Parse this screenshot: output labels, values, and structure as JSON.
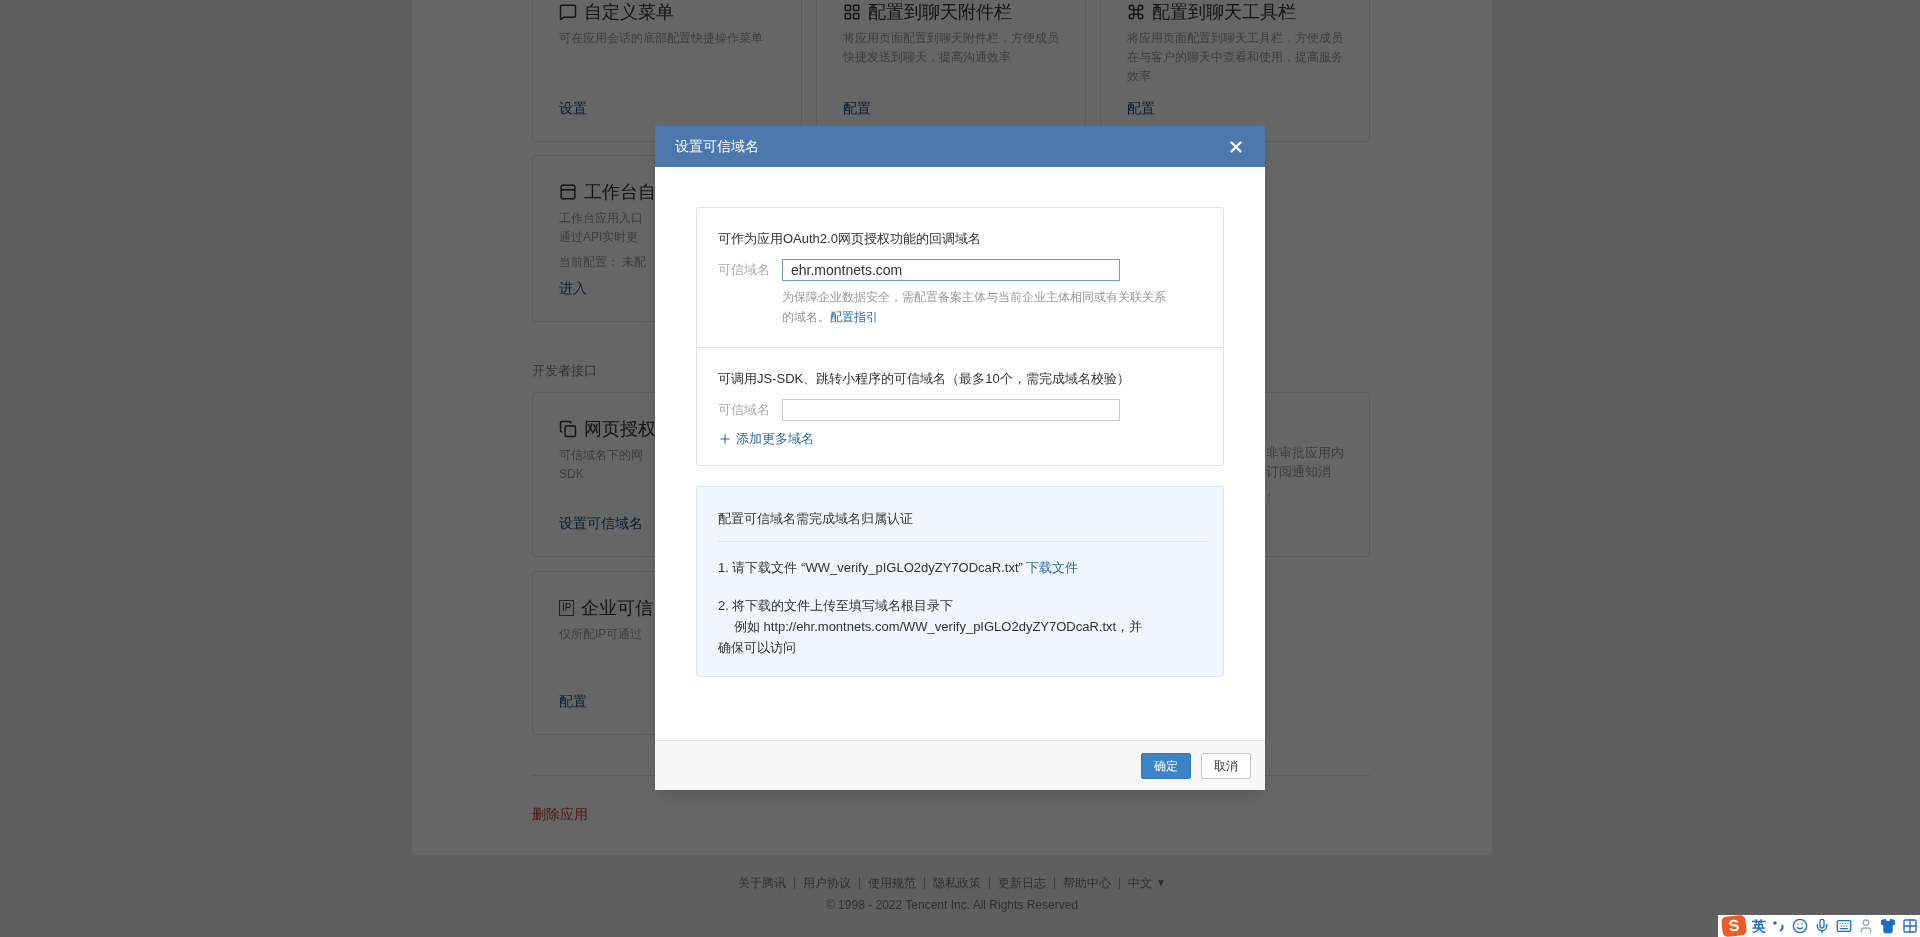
{
  "page": {
    "rows": [
      {
        "cards": [
          {
            "kind": "menu",
            "title": "自定义菜单",
            "description": [
              "可在应用会话的底部配置快捷操作菜单"
            ],
            "action": "设置"
          },
          {
            "kind": "attachment",
            "title": "配置到聊天附件栏",
            "description": [
              "将应用页面配置到聊天附件栏，方便成员",
              "快捷发送到聊天，提高沟通效率"
            ],
            "action": "配置"
          },
          {
            "kind": "toolbar",
            "title": "配置到聊天工具栏",
            "description": [
              "将应用页面配置到聊天工具栏，方便成员",
              "在与客户的聊天中查看和使用，提高服务",
              "效率"
            ],
            "action": "配置"
          }
        ]
      },
      {
        "cards": [
          {
            "kind": "workbench",
            "title": "工作台自",
            "description": [
              "工作台应用入口",
              "通过API实时更"
            ],
            "status": "当前配置： 未配",
            "action": "进入"
          }
        ]
      }
    ],
    "developer_section": {
      "label": "开发者接口",
      "rows": [
        {
          "cards": [
            {
              "kind": "webauth",
              "title": "网页授权",
              "description": [
                "可信域名下的网",
                "SDK"
              ],
              "action": "设置可信域名"
            },
            {
              "kind": "partial",
              "description": [
                "非审批应用内",
                "订阅通知消",
                "。"
              ]
            }
          ]
        },
        {
          "cards": [
            {
              "kind": "ip",
              "icon_text": "IP",
              "title": "企业可信",
              "description": [
                "仅所配IP可通过"
              ],
              "action": "配置"
            }
          ]
        }
      ]
    },
    "delete_action": "删除应用"
  },
  "footer": {
    "links": [
      "关于腾讯",
      "用户协议",
      "使用规范",
      "隐私政策",
      "更新日志",
      "帮助中心"
    ],
    "language": "中文",
    "language_caret": "▼",
    "copyright": "© 1998 - 2022 Tencent Inc. All Rights Reserved"
  },
  "dialog": {
    "title": "设置可信域名",
    "sections": [
      {
        "heading": "可作为应用OAuth2.0网页授权功能的回调域名",
        "field_label": "可信域名",
        "value": "ehr.montnets.com",
        "focused": true,
        "hint": [
          "为保障企业数据安全，需配置备案主体与当前企业主体相同或有关联关系",
          "的域名。"
        ],
        "hint_link": "配置指引"
      },
      {
        "heading": "可调用JS-SDK、跳转小程序的可信域名（最多10个，需完成域名校验）",
        "field_label": "可信域名",
        "focused": false,
        "add_link": "添加更多域名"
      }
    ],
    "verification": {
      "title": "配置可信域名需完成域名归属认证",
      "step1": "1. 请下载文件 “WW_verify_pIGLO2dyZY7ODcaR.txt”",
      "step1_link": "下载文件",
      "step2": [
        "2. 将下载的文件上传至填写域名根目录下",
        "例如 http://ehr.montnets.com/WW_verify_pIGLO2dyZY7ODcaR.txt，并",
        "确保可以访问"
      ]
    },
    "buttons": [
      {
        "label": "确定",
        "kind": "primary"
      },
      {
        "label": "取消",
        "kind": "secondary"
      }
    ]
  },
  "ime_toolbar": {
    "logo": "S",
    "mode": "英"
  }
}
